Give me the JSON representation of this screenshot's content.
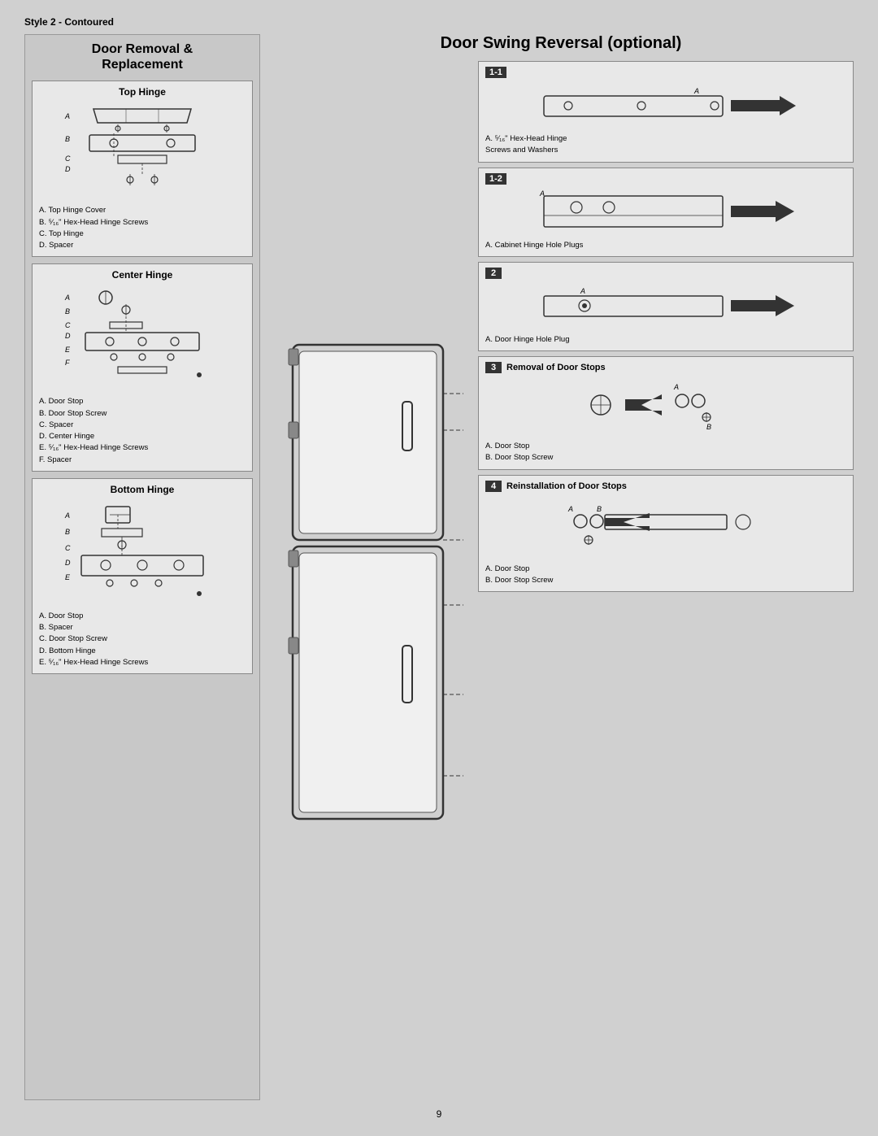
{
  "page": {
    "style_label": "Style 2 - Contoured",
    "page_number": "9"
  },
  "left": {
    "title_line1": "Door Removal &",
    "title_line2": "Replacement",
    "hinges": [
      {
        "id": "top-hinge",
        "title": "Top Hinge",
        "labels": [
          "A. Top Hinge Cover",
          "B. ⁵⁄₁₆\" Hex-Head Hinge Screws",
          "C. Top Hinge",
          "D. Spacer"
        ],
        "parts": [
          "A",
          "B",
          "C",
          "D"
        ]
      },
      {
        "id": "center-hinge",
        "title": "Center Hinge",
        "labels": [
          "A. Door Stop",
          "B. Door Stop Screw",
          "C. Spacer",
          "D. Center Hinge",
          "E. ⁵⁄₁₆\" Hex-Head Hinge Screws",
          "F. Spacer"
        ],
        "parts": [
          "A",
          "B",
          "C",
          "D",
          "E",
          "F"
        ]
      },
      {
        "id": "bottom-hinge",
        "title": "Bottom Hinge",
        "labels": [
          "A. Door Stop",
          "B. Spacer",
          "C. Door Stop Screw",
          "D. Bottom Hinge",
          "E. ⁵⁄₁₆\" Hex-Head Hinge Screws"
        ],
        "parts": [
          "A",
          "B",
          "C",
          "D",
          "E"
        ]
      }
    ]
  },
  "right": {
    "title": "Door Swing Reversal (optional)",
    "steps": [
      {
        "id": "step-1-1",
        "number": "1-1",
        "title": "",
        "label_a": "A. ⁵⁄₁₆\" Hex-Head Hinge",
        "label_b": "Screws and Washers",
        "show_title": false
      },
      {
        "id": "step-1-2",
        "number": "1-2",
        "title": "",
        "label_a": "A. Cabinet Hinge Hole Plugs",
        "show_title": false
      },
      {
        "id": "step-2",
        "number": "2",
        "title": "",
        "label_a": "A. Door Hinge Hole Plug",
        "show_title": false
      },
      {
        "id": "step-3",
        "number": "3",
        "title": "Removal of Door Stops",
        "label_a": "A. Door Stop",
        "label_b": "B. Door Stop Screw",
        "show_title": true
      },
      {
        "id": "step-4",
        "number": "4",
        "title": "Reinstallation of Door Stops",
        "label_a": "A. Door Stop",
        "label_b": "B. Door Stop Screw",
        "show_title": true
      }
    ]
  }
}
